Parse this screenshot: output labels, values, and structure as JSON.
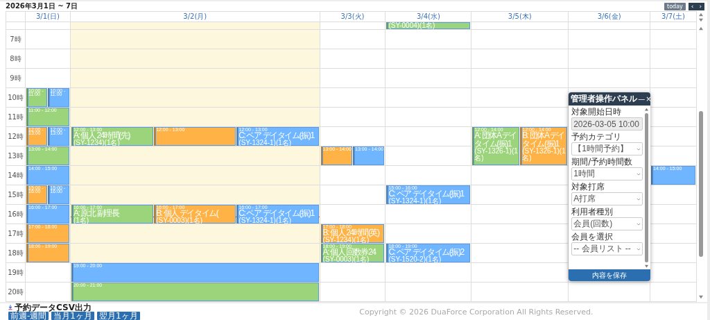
{
  "calendar": {
    "title": "2026年3月1日 ~ 7日",
    "today_button": "today",
    "prev_button": "‹",
    "next_button": "›",
    "days": [
      {
        "label": "3/1(日)",
        "today": false
      },
      {
        "label": "3/2(月)",
        "today": true
      },
      {
        "label": "3/3(火)",
        "today": false
      },
      {
        "label": "3/4(水)",
        "today": false
      },
      {
        "label": "3/5(木)",
        "today": false
      },
      {
        "label": "3/6(金)",
        "today": false
      },
      {
        "label": "3/7(土)",
        "today": false
      }
    ],
    "rows": [
      {
        "cells": [
          {},
          {},
          {},
          {
            "events": [
              {
                "color": "#9bd47a",
                "code": "(SY-0004)(1名)"
              }
            ]
          },
          {},
          {},
          {}
        ]
      },
      {
        "label": "7時",
        "cells": [
          {},
          {},
          {},
          {},
          {},
          {},
          {}
        ]
      },
      {
        "label": "8時",
        "cells": [
          {},
          {},
          {},
          {},
          {},
          {},
          {}
        ]
      },
      {
        "label": "9時",
        "cells": [
          {},
          {},
          {},
          {},
          {},
          {},
          {}
        ]
      },
      {
        "label": "10時",
        "cells": [
          {
            "events": [
              {
                "color": "#9bd47a",
                "time": "10:00 - 11:00"
              },
              {
                "color": "#6fb5ff",
                "time": "10:00 - 11:00"
              }
            ]
          },
          {},
          {},
          {},
          {},
          {},
          {}
        ]
      },
      {
        "label": "11時",
        "cells": [
          {
            "events": [
              {
                "color": "#9bd47a",
                "time": "11:00 - 12:00"
              }
            ]
          },
          {},
          {},
          {},
          {},
          {},
          {}
        ]
      },
      {
        "label": "12時",
        "cells": [
          {
            "events": [
              {
                "color": "#ffb347",
                "time": "12:00 - 13:00"
              },
              {
                "color": "#6fb5ff",
                "time": "12:00 - 13:00"
              }
            ]
          },
          {
            "events": [
              {
                "color": "#9bd47a",
                "time": "12:00 - 13:00",
                "title": "A: 個人 24時間(先)",
                "code": "(SY-1234)(1名)"
              },
              {
                "color": "#ffb347",
                "time": "12:00 - 13:00"
              },
              {
                "color": "#6fb5ff",
                "time": "12:00 - 13:00",
                "title": "C: ペア デイタイム(振)1",
                "code": "(SY-1324-1)(1名)"
              }
            ]
          },
          {},
          {},
          {
            "long": true,
            "events": [
              {
                "color": "#9bd47a",
                "time": "12:00 - 14:00",
                "title": "A: 団体A デイタイム(振)1",
                "code": "(SY-1326-1)(1名)"
              },
              {
                "color": "#ffb347",
                "time": "12:00 - 14:00",
                "title": "B: 団体A デイタイム(振)1",
                "code": "(SY-1326-1)(1名)"
              }
            ]
          },
          {},
          {}
        ]
      },
      {
        "label": "13時",
        "cells": [
          {
            "events": [
              {
                "color": "#9bd47a",
                "time": "13:00 - 14:00"
              }
            ]
          },
          {},
          {
            "events": [
              {
                "color": "#ffb347",
                "time": "13:00 - 14:00"
              },
              {
                "color": "#6fb5ff",
                "time": "13:00 - 14:00"
              }
            ]
          },
          {},
          {},
          {},
          {}
        ]
      },
      {
        "label": "14時",
        "cells": [
          {
            "events": [
              {
                "color": "#6fb5ff",
                "time": "14:00 - 15:00"
              }
            ]
          },
          {},
          {},
          {},
          {},
          {},
          {
            "events": [
              {
                "color": "#6fb5ff",
                "time": "14:00 - 15:00"
              }
            ]
          }
        ]
      },
      {
        "label": "15時",
        "cells": [
          {
            "events": [
              {
                "color": "#ffb347",
                "time": "15:00 - 16:00"
              },
              {
                "color": "#6fb5ff",
                "time": "15:00 - 16:00"
              }
            ]
          },
          {},
          {},
          {
            "events": [
              {
                "color": "#6fb5ff",
                "time": "15:00 - 16:00",
                "title": "C: ペア デイタイム(振)1",
                "code": "(SY-1324-1)(1名)"
              }
            ]
          },
          {},
          {},
          {}
        ]
      },
      {
        "label": "16時",
        "cells": [
          {
            "events": [
              {
                "color": "#6fb5ff",
                "time": "16:00 - 17:00"
              }
            ]
          },
          {
            "now": true,
            "events": [
              {
                "color": "#9bd47a",
                "time": "16:00 - 17:00",
                "title": "A: 原北 副理長",
                "code": "(1名)"
              },
              {
                "color": "#ffb347",
                "time": "16:00 - 17:00",
                "title": "B: 個人 デイタイム(",
                "code": "(SY-0003)(1名)"
              },
              {
                "color": "#6fb5ff",
                "time": "16:00 - 17:00",
                "title": "C: ペア デイタイム(振)1",
                "code": "(SY-1324-1)(1名)"
              }
            ]
          },
          {},
          {},
          {},
          {},
          {}
        ]
      },
      {
        "label": "17時",
        "cells": [
          {
            "events": [
              {
                "color": "#ffb347",
                "time": "17:00 - 18:00"
              }
            ]
          },
          {},
          {
            "events": [
              {
                "color": "#ffb347",
                "time": "17:00 - 18:00",
                "title": "B: 個人 24時間(英)",
                "code": "(SY-1234)(1名)"
              }
            ]
          },
          {},
          {},
          {},
          {}
        ]
      },
      {
        "label": "18時",
        "cells": [
          {
            "events": [
              {
                "color": "#ffb347",
                "time": "18:00 - 19:00"
              }
            ]
          },
          {},
          {
            "events": [
              {
                "color": "#9bd47a",
                "time": "18:00 - 19:00",
                "title": "A: 個人 回数券24",
                "code": "(SY-0003)(1名)"
              }
            ]
          },
          {
            "events": [
              {
                "color": "#6fb5ff",
                "time": "18:00 - 19:00",
                "title": "C: ペア デイタイム(振)2",
                "code": "(SY-1520-2)(1名)"
              }
            ]
          },
          {},
          {},
          {}
        ]
      },
      {
        "label": "19時",
        "cells": [
          {},
          {
            "events": [
              {
                "color": "#6fb5ff",
                "time": "19:00 - 20:00"
              }
            ]
          },
          {},
          {},
          {},
          {},
          {}
        ]
      },
      {
        "label": "20時",
        "cells": [
          {},
          {
            "events": [
              {
                "color": "#9bd47a",
                "time": "20:00 - 21:00"
              }
            ]
          },
          {},
          {},
          {},
          {},
          {}
        ]
      }
    ]
  },
  "panel": {
    "title": "管理者操作パネル",
    "minimize": "—",
    "close": "×",
    "fields": [
      {
        "label": "対象開始日時",
        "value": "2026-03-05 10:00",
        "disabled": true
      },
      {
        "label": "予約カテゴリ",
        "value": "【1時間予約】",
        "disabled": false
      },
      {
        "label": "期間/予約時間数",
        "value": "1時間",
        "disabled": false
      },
      {
        "label": "対象打席",
        "value": "A打席",
        "disabled": false
      },
      {
        "label": "利用者種別",
        "value": "会員(回数)",
        "disabled": false
      },
      {
        "label": "会員を選択",
        "value": "-- 会員リスト --",
        "disabled": false
      }
    ],
    "save_button": "内容を保存"
  },
  "footer": {
    "export_title": "予約データCSV出力",
    "buttons": [
      "前週-週間",
      "当月1ヶ月",
      "翌月1ヶ月"
    ],
    "copyright": "Copyright © 2026 DuaForce Corporation All Rights Reserved."
  }
}
